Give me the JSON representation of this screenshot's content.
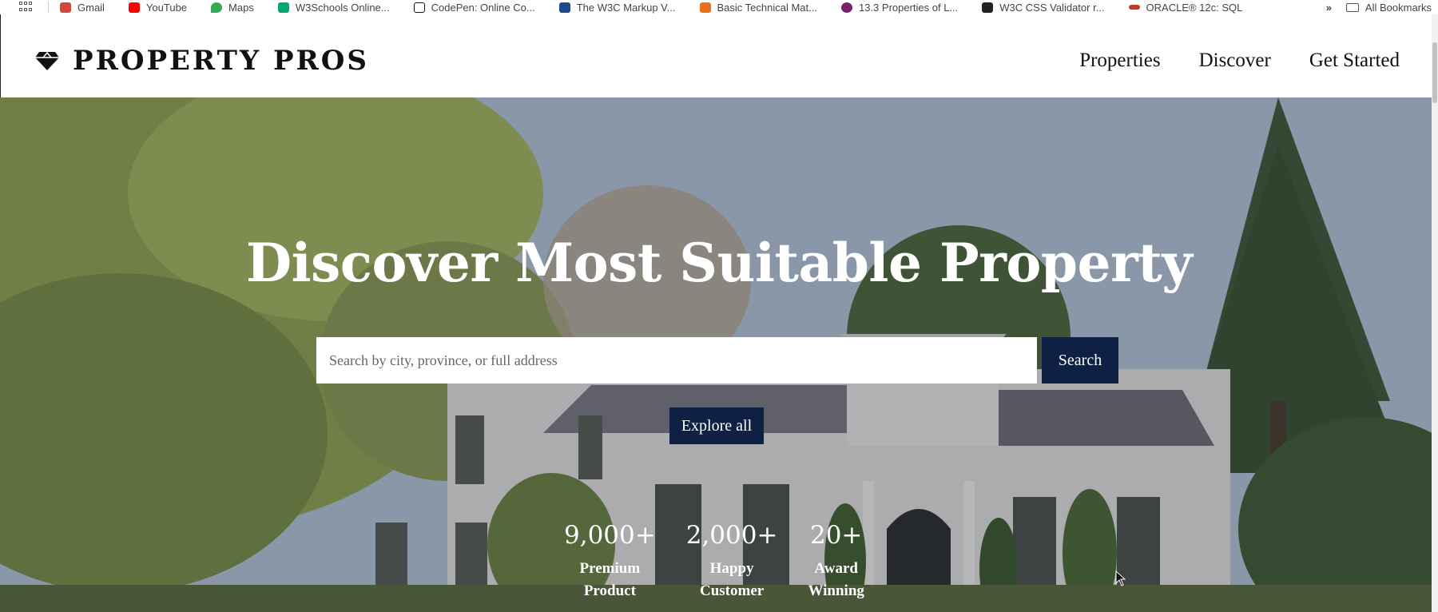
{
  "bookmarks": {
    "items": [
      {
        "label": "Gmail",
        "color": "#d44638"
      },
      {
        "label": "YouTube",
        "color": "#ff0000"
      },
      {
        "label": "Maps",
        "color": "#34a853"
      },
      {
        "label": "W3Schools Online...",
        "color": "#04aa6d"
      },
      {
        "label": "CodePen: Online Co...",
        "color": "#111111"
      },
      {
        "label": "The W3C Markup V...",
        "color": "#1a4a8a"
      },
      {
        "label": "Basic Technical Mat...",
        "color": "#e8711c"
      },
      {
        "label": "13.3 Properties of L...",
        "color": "#7a1f6e"
      },
      {
        "label": "W3C CSS Validator r...",
        "color": "#222222"
      },
      {
        "label": "ORACLE® 12c: SQL",
        "color": "#c0392b"
      }
    ],
    "more": "»",
    "all_bookmarks": "All Bookmarks"
  },
  "header": {
    "logo_text": "PROPERTY PROS",
    "nav": [
      "Properties",
      "Discover",
      "Get Started"
    ]
  },
  "hero": {
    "title": "Discover Most Suitable Property",
    "search_placeholder": "Search by city, province, or full address",
    "search_button": "Search",
    "explore_button": "Explore all",
    "stats": [
      {
        "value": "9,000+",
        "label_line1": "Premium",
        "label_line2": "Product"
      },
      {
        "value": "2,000+",
        "label_line1": "Happy",
        "label_line2": "Customer"
      },
      {
        "value": "20+",
        "label_line1": "Award",
        "label_line2": "Winning"
      }
    ]
  },
  "colors": {
    "primary": "#0e2145",
    "text": "#111111",
    "hero_text": "#ffffff"
  }
}
